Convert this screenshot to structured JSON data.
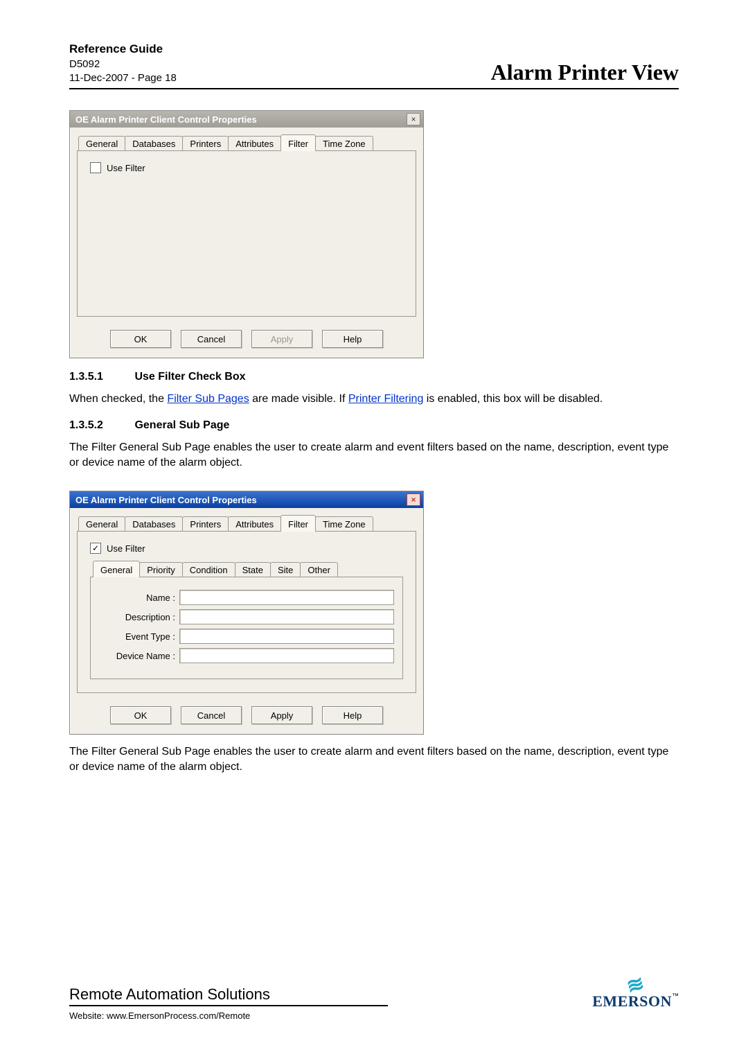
{
  "header": {
    "guide_title": "Reference Guide",
    "doc_code": "D5092",
    "date_page": "11-Dec-2007 - Page 18",
    "page_title": "Alarm Printer View"
  },
  "dialog1": {
    "title": "OE Alarm Printer Client Control Properties",
    "close_glyph": "×",
    "tabs": [
      "General",
      "Databases",
      "Printers",
      "Attributes",
      "Filter",
      "Time Zone"
    ],
    "active_tab_index": 4,
    "use_filter_label": "Use Filter",
    "use_filter_checked": false,
    "buttons": {
      "ok": "OK",
      "cancel": "Cancel",
      "apply": "Apply",
      "help": "Help",
      "apply_disabled": true
    }
  },
  "section1": {
    "num": "1.3.5.1",
    "title": "Use Filter Check Box",
    "text_pre": "When checked, the ",
    "link1": "Filter Sub Pages",
    "text_mid": " are made visible.  If ",
    "link2": "Printer Filtering",
    "text_post": " is enabled, this box will be disabled."
  },
  "section2": {
    "num": "1.3.5.2",
    "title": "General Sub Page",
    "text": "The Filter General Sub Page enables the user to create alarm and event filters based on the name, description, event type or device name of the alarm object."
  },
  "dialog2": {
    "title": "OE Alarm Printer Client Control Properties",
    "close_glyph": "×",
    "tabs": [
      "General",
      "Databases",
      "Printers",
      "Attributes",
      "Filter",
      "Time Zone"
    ],
    "active_tab_index": 4,
    "use_filter_label": "Use Filter",
    "use_filter_checked": true,
    "subtabs": [
      "General",
      "Priority",
      "Condition",
      "State",
      "Site",
      "Other"
    ],
    "active_subtab_index": 0,
    "fields": {
      "name_label": "Name :",
      "name_value": "",
      "description_label": "Description :",
      "description_value": "",
      "event_type_label": "Event Type :",
      "event_type_value": "",
      "device_name_label": "Device Name :",
      "device_name_value": ""
    },
    "buttons": {
      "ok": "OK",
      "cancel": "Cancel",
      "apply": "Apply",
      "help": "Help",
      "apply_disabled": false
    }
  },
  "repeat_text": "The Filter General Sub Page enables the user to create alarm and event filters based on the name, description, event type or device name of the alarm object.",
  "footer": {
    "company": "Remote Automation Solutions",
    "website_label": "Website:  www.EmersonProcess.com/Remote",
    "logo_mark": "≋",
    "logo_wordmark": "EMERSON",
    "logo_reg": "™"
  }
}
